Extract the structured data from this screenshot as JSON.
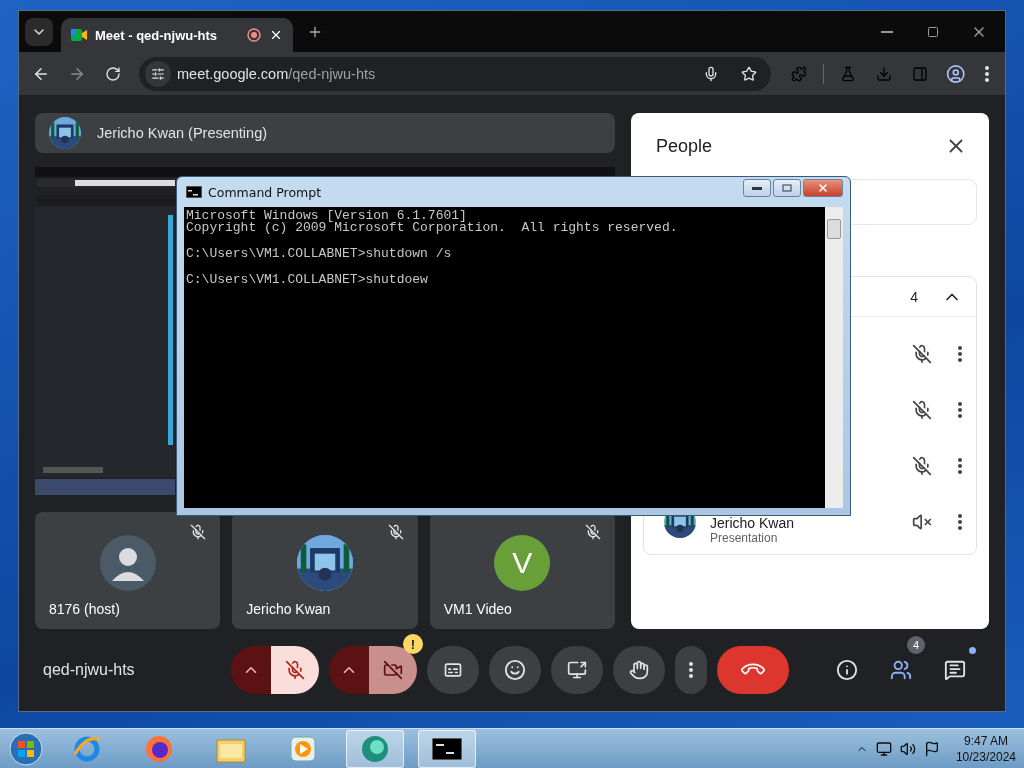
{
  "browser": {
    "tab": {
      "title": "Meet - qed-njwu-hts"
    },
    "address": {
      "host": "meet.google.com",
      "path": "/qed-njwu-hts"
    }
  },
  "meet": {
    "presenter": {
      "label": "Jericho Kwan (Presenting)"
    },
    "tiles": [
      {
        "name": "8176 (host)",
        "kind": "silhouette",
        "muted": true
      },
      {
        "name": "Jericho Kwan",
        "kind": "picture",
        "muted": true
      },
      {
        "name": "VM1 Video",
        "kind": "letter",
        "letter": "V",
        "color": "#689f38",
        "muted": true
      }
    ],
    "people": {
      "title": "People",
      "group": {
        "count": "4",
        "expanded": true,
        "participants": [
          {
            "kind": "mic"
          },
          {
            "kind": "mic"
          },
          {
            "kind": "mic"
          },
          {
            "kind": "audio",
            "name": "Jericho Kwan",
            "role": "Presentation"
          }
        ]
      }
    },
    "meeting_code": "qed-njwu-hts",
    "controls": [
      {
        "kind": "mic",
        "on": false
      },
      {
        "kind": "camera",
        "on": false,
        "warning": "!"
      },
      {
        "kind": "captions"
      },
      {
        "kind": "emoji"
      },
      {
        "kind": "present"
      },
      {
        "kind": "hand"
      },
      {
        "kind": "more"
      },
      {
        "kind": "hangup"
      }
    ],
    "side_buttons": [
      {
        "kind": "info"
      },
      {
        "kind": "people",
        "badge": "4"
      },
      {
        "kind": "chat",
        "unread": true
      }
    ]
  },
  "command_prompt": {
    "title": "Command Prompt",
    "blocks": [
      [
        "Microsoft Windows [Version 6.1.7601]",
        "Copyright (c) 2009 Microsoft Corporation.  All rights reserved."
      ],
      [
        "C:\\Users\\VM1.COLLABNET>shutdown /s"
      ],
      [
        "C:\\Users\\VM1.COLLABNET>shutdoew"
      ]
    ]
  },
  "taskbar": {
    "apps": [
      {
        "kind": "ie",
        "active": false
      },
      {
        "kind": "firefox",
        "active": false
      },
      {
        "kind": "explorer",
        "active": false
      },
      {
        "kind": "media",
        "active": false
      },
      {
        "kind": "meet",
        "active": true
      },
      {
        "kind": "cmd",
        "active": true
      }
    ],
    "time": "9:47 AM",
    "date": "10/23/2024"
  }
}
